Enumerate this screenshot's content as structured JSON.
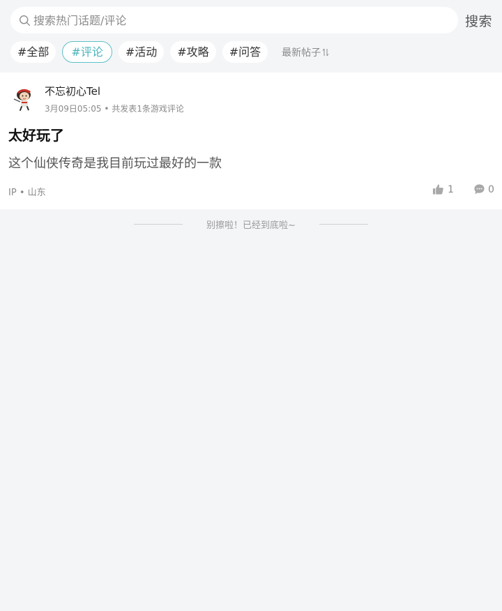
{
  "search": {
    "placeholder": "搜索热门话题/评论",
    "value": "",
    "button_label": "搜索"
  },
  "tags": [
    {
      "label": "#全部",
      "active": false
    },
    {
      "label": "#评论",
      "active": true
    },
    {
      "label": "#活动",
      "active": false
    },
    {
      "label": "#攻略",
      "active": false
    },
    {
      "label": "#问答",
      "active": false
    }
  ],
  "sort": {
    "label": "最新帖子",
    "icon": "sort-arrows-icon"
  },
  "post": {
    "username": "不忘初心Tel",
    "time": "3月09日05:05",
    "separator": "•",
    "summary": "共发表1条游戏评论",
    "title": "太好玩了",
    "body": "这个仙侠传奇是我目前玩过最好的一款",
    "ip_label": "IP",
    "location": "山东",
    "likes": "1",
    "comments": "0"
  },
  "footer": {
    "end_text": "别擦啦！已经到底啦~"
  },
  "colors": {
    "background": "#f4f5f7",
    "accent": "#47b3bb",
    "muted": "#8a8a8a"
  }
}
